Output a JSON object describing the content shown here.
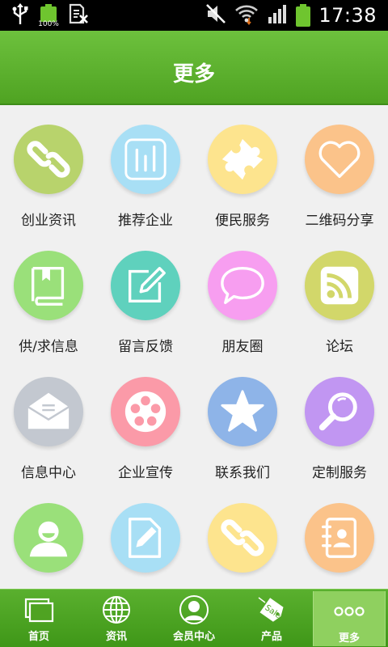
{
  "status_bar": {
    "battery_percent_label": "100%",
    "time": "17:38",
    "icons": [
      "usb-icon",
      "battery-charging-icon",
      "sim-icon",
      "mute-icon",
      "wifi-icon",
      "signal-icon",
      "battery-icon"
    ]
  },
  "header": {
    "title": "更多"
  },
  "grid": {
    "items": [
      {
        "label": "创业资讯",
        "icon": "chain-link-icon",
        "color": "#b8d36c"
      },
      {
        "label": "推荐企业",
        "icon": "bar-chart-icon",
        "color": "#a8dff5"
      },
      {
        "label": "便民服务",
        "icon": "puzzle-icon",
        "color": "#fde48e"
      },
      {
        "label": "二维码分享",
        "icon": "heart-icon",
        "color": "#fbc38a"
      },
      {
        "label": "供/求信息",
        "icon": "book-icon",
        "color": "#9ae07a"
      },
      {
        "label": "留言反馈",
        "icon": "pencil-square-icon",
        "color": "#5fd1bd"
      },
      {
        "label": "朋友圈",
        "icon": "speech-bubble-icon",
        "color": "#f79ef0"
      },
      {
        "label": "论坛",
        "icon": "rss-icon",
        "color": "#d2d76a"
      },
      {
        "label": "信息中心",
        "icon": "envelope-icon",
        "color": "#c3c8d0"
      },
      {
        "label": "企业宣传",
        "icon": "film-reel-icon",
        "color": "#fb9aa8"
      },
      {
        "label": "联系我们",
        "icon": "star-icon",
        "color": "#8eb4e8"
      },
      {
        "label": "定制服务",
        "icon": "magnifier-icon",
        "color": "#c196f2"
      },
      {
        "label": "",
        "icon": "user-icon",
        "color": "#9ae07a"
      },
      {
        "label": "",
        "icon": "document-pen-icon",
        "color": "#a8dff5"
      },
      {
        "label": "",
        "icon": "chain-link-icon",
        "color": "#fde48e"
      },
      {
        "label": "",
        "icon": "contacts-book-icon",
        "color": "#fbc38a"
      }
    ]
  },
  "tab_bar": {
    "tabs": [
      {
        "label": "首页",
        "icon": "home-windows-icon"
      },
      {
        "label": "资讯",
        "icon": "globe-icon"
      },
      {
        "label": "会员中心",
        "icon": "member-avatar-icon"
      },
      {
        "label": "产品",
        "icon": "sale-tag-icon",
        "tag_text": "Sale"
      },
      {
        "label": "更多",
        "icon": "more-dots-icon",
        "active": true
      }
    ]
  }
}
